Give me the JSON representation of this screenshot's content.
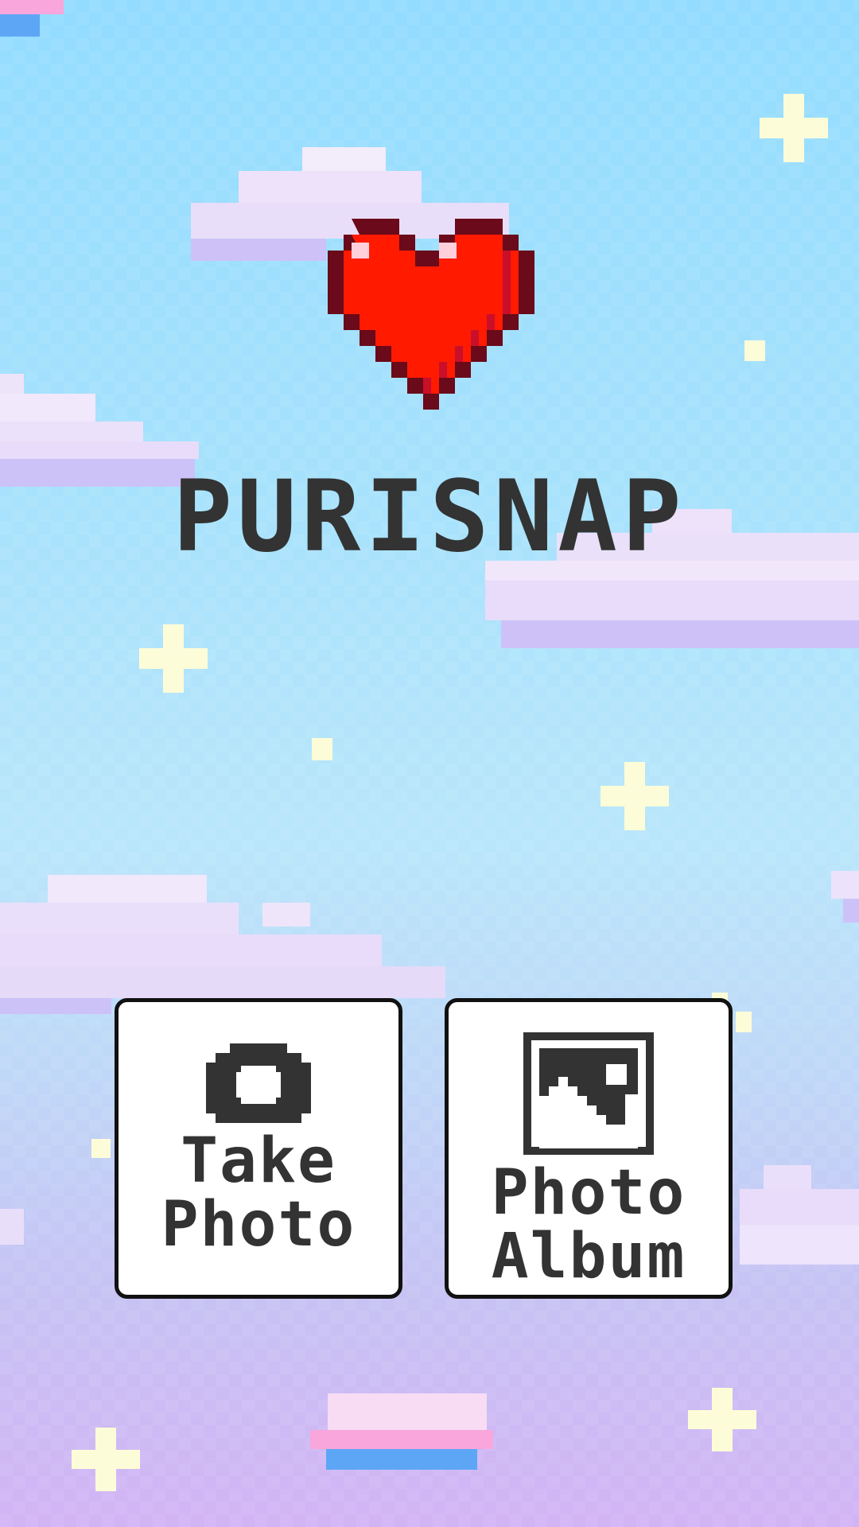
{
  "app": {
    "title": "PURISNAP"
  },
  "buttons": {
    "take_photo": {
      "line1": "Take",
      "line2": "Photo",
      "icon": "camera-icon"
    },
    "photo_album": {
      "line1": "Photo",
      "line2": "Album",
      "icon": "image-icon"
    }
  },
  "decor": {
    "logo_icon": "pixel-heart-icon",
    "heart_color": "#ff1a00",
    "text_color": "#333333",
    "sky_top_color": "#93dcff",
    "sky_bottom_color": "#d2b4f5"
  }
}
